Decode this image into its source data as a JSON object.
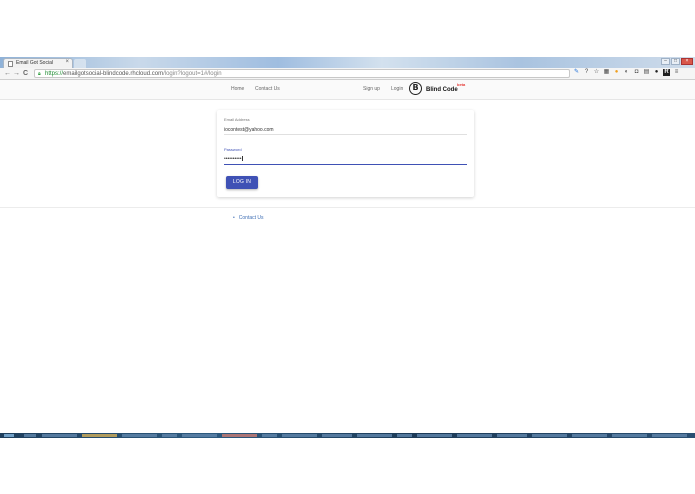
{
  "browser": {
    "tab_title": "Email Got Social",
    "tab_close": "×",
    "window_controls": [
      "–",
      "□",
      "×"
    ],
    "nav": {
      "back": "←",
      "forward": "→",
      "reload": "C"
    },
    "url_scheme": "https://",
    "url_host": "emailgotsocial-blindcode.rhcloud.com",
    "url_path": "/login?logout=1#/login",
    "extension_icons": [
      "pencil-icon",
      "question-icon",
      "star-icon",
      "grid-icon",
      "circle-icon",
      "moon-icon",
      "shield-icon",
      "box-icon",
      "dark-circle-icon",
      "r-icon",
      "menu-icon"
    ],
    "extension_glyphs": [
      "✎",
      "?",
      "☆",
      "▦",
      "●",
      "◐",
      "◘",
      "▤",
      "●",
      "R",
      "≡"
    ]
  },
  "site_nav": {
    "home": "Home",
    "contact": "Contact Us",
    "signup": "Sign up",
    "login": "Login",
    "logo_mark": "B",
    "logo_text": "Blind Code",
    "logo_beta": "beta"
  },
  "login_form": {
    "email_label": "Email Address",
    "email_value": "iocontest@yahoo.com",
    "password_label": "Password",
    "password_value": "••••••••••",
    "submit_label": "LOG IN"
  },
  "footer": {
    "links": [
      "Contact Us"
    ]
  },
  "colors": {
    "primary": "#3f51b5",
    "link": "#3f6fb5",
    "beta": "#e53935"
  }
}
